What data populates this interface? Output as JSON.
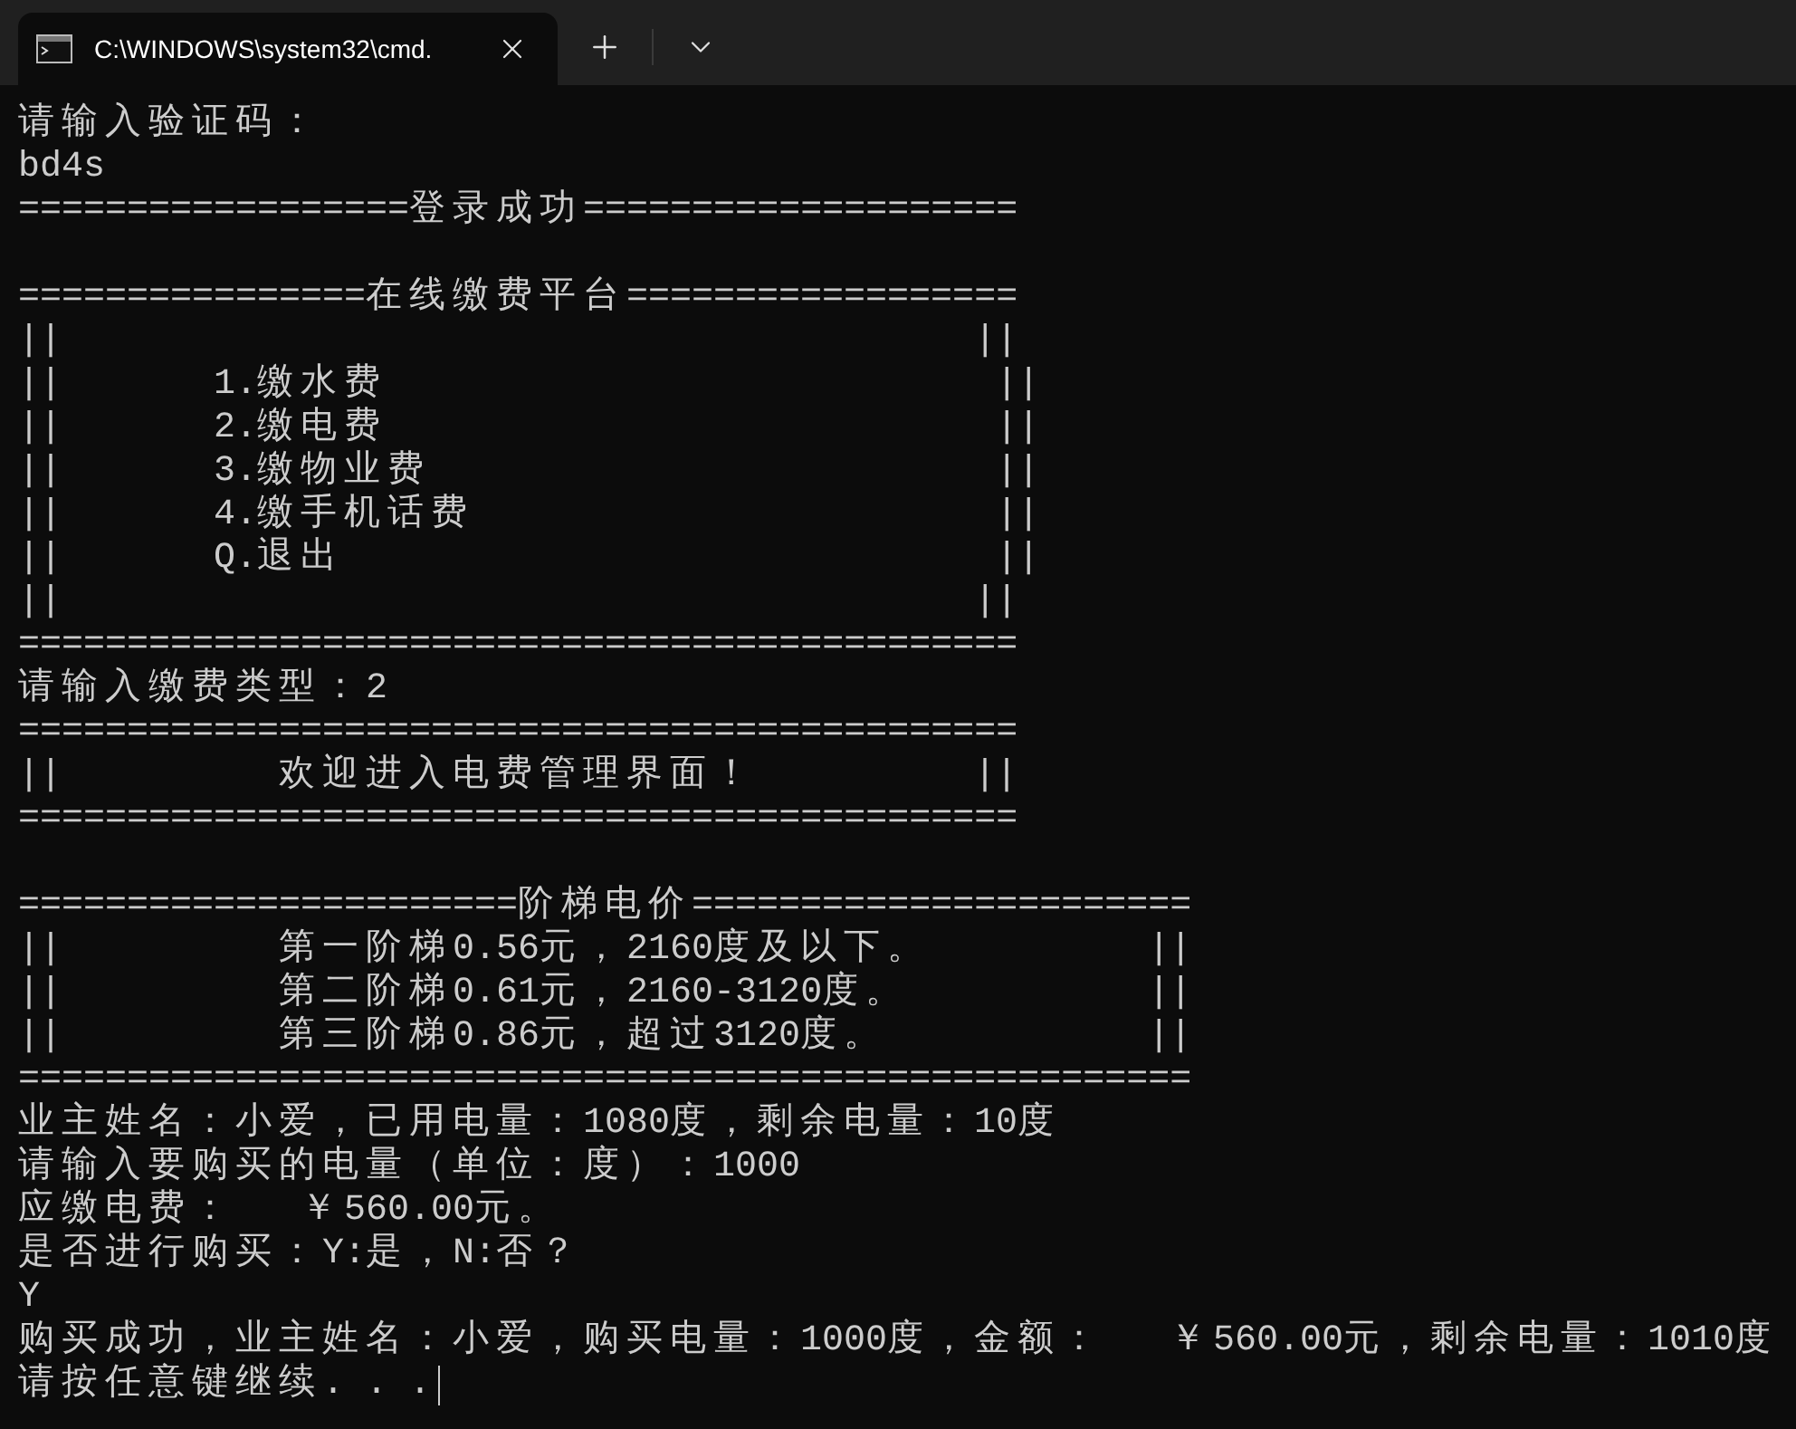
{
  "tabs": [
    {
      "title": "C:\\WINDOWS\\system32\\cmd.",
      "selected": true
    }
  ],
  "terminal": {
    "lines": [
      {
        "kind": "text",
        "text": "请输入验证码："
      },
      {
        "kind": "text",
        "text": "bd4s"
      },
      {
        "kind": "text",
        "text": "==================登录成功===================="
      },
      {
        "kind": "blank"
      },
      {
        "kind": "text",
        "text": "================在线缴费平台=================="
      },
      {
        "kind": "text",
        "text": "||                                          ||"
      },
      {
        "kind": "text",
        "text": "||       1.缴水费                            ||"
      },
      {
        "kind": "text",
        "text": "||       2.缴电费                            ||"
      },
      {
        "kind": "text",
        "text": "||       3.缴物业费                          ||"
      },
      {
        "kind": "text",
        "text": "||       4.缴手机话费                        ||"
      },
      {
        "kind": "text",
        "text": "||       Q.退出                              ||"
      },
      {
        "kind": "text",
        "text": "||                                          ||"
      },
      {
        "kind": "text",
        "text": "=============================================="
      },
      {
        "kind": "text",
        "text": "请输入缴费类型：2"
      },
      {
        "kind": "text",
        "text": "=============================================="
      },
      {
        "kind": "text",
        "text": "||          欢迎进入电费管理界面！          ||"
      },
      {
        "kind": "text",
        "text": "=============================================="
      },
      {
        "kind": "blank"
      },
      {
        "kind": "text",
        "text": "=======================阶梯电价======================="
      },
      {
        "kind": "text",
        "text": "||          第一阶梯0.56元，2160度及以下。          ||"
      },
      {
        "kind": "text",
        "text": "||          第二阶梯0.61元，2160-3120度。           ||"
      },
      {
        "kind": "text",
        "text": "||          第三阶梯0.86元，超过3120度。            ||"
      },
      {
        "kind": "text",
        "text": "======================================================"
      },
      {
        "kind": "text",
        "text": "业主姓名：小爱，已用电量：1080度，剩余电量：10度"
      },
      {
        "kind": "text",
        "text": "请输入要购买的电量（单位：度）：1000"
      },
      {
        "kind": "text",
        "text": "应缴电费：   ￥560.00元。"
      },
      {
        "kind": "text",
        "text": "是否进行购买：Y:是，N:否？"
      },
      {
        "kind": "text",
        "text": "Y"
      },
      {
        "kind": "text",
        "text": "购买成功，业主姓名：小爱，购买电量：1000度，金额：   ￥560.00元，剩余电量：1010度"
      },
      {
        "kind": "text",
        "text": "请按任意键继续. . .",
        "cursor": true
      }
    ]
  }
}
